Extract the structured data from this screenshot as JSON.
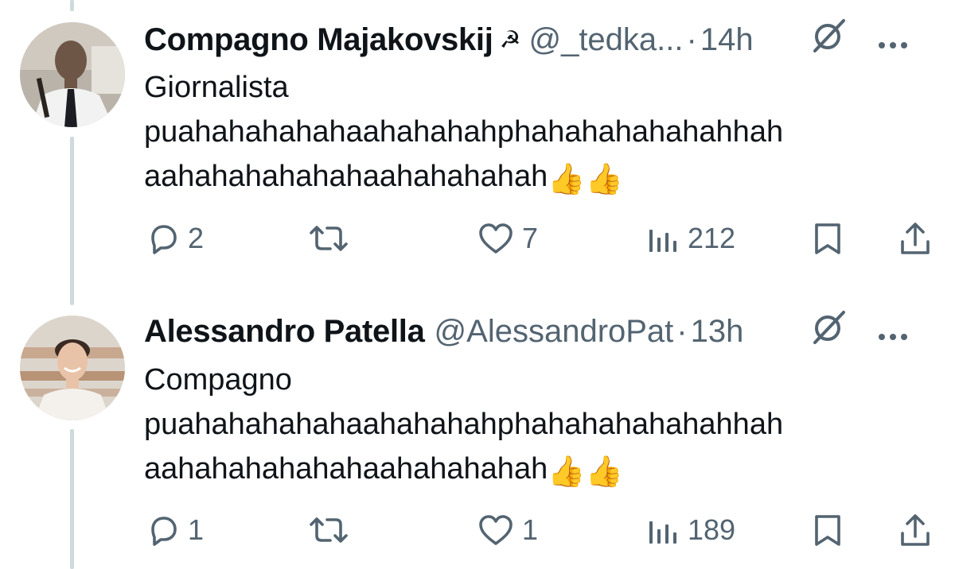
{
  "tweets": [
    {
      "name": "Compagno Majakovskij",
      "badge": "☭",
      "handle": "@_tedka...",
      "dot": "·",
      "time": "14h",
      "lines": [
        "Giornalista",
        "puahahahahahaahahahahphahahahahahahhah",
        "aahahahahahahaahahahahah"
      ],
      "emoji": "👍👍",
      "replies": "2",
      "likes": "7",
      "views": "212"
    },
    {
      "name": "Alessandro Patella",
      "handle": "@AlessandroPat",
      "dot": "·",
      "time": "13h",
      "lines": [
        "Compagno",
        "puahahahahahaahahahahphahahahahahahhah",
        "aahahahahahahaahahahahah"
      ],
      "emoji": "👍👍",
      "replies": "1",
      "likes": "1",
      "views": "189"
    }
  ],
  "colors": {
    "text": "#0f1419",
    "secondary": "#536471",
    "thread_line": "#cfd9de"
  },
  "icons": [
    "reply-icon",
    "retweet-icon",
    "like-icon",
    "views-icon",
    "bookmark-icon",
    "share-icon",
    "grok-icon",
    "more-icon"
  ]
}
